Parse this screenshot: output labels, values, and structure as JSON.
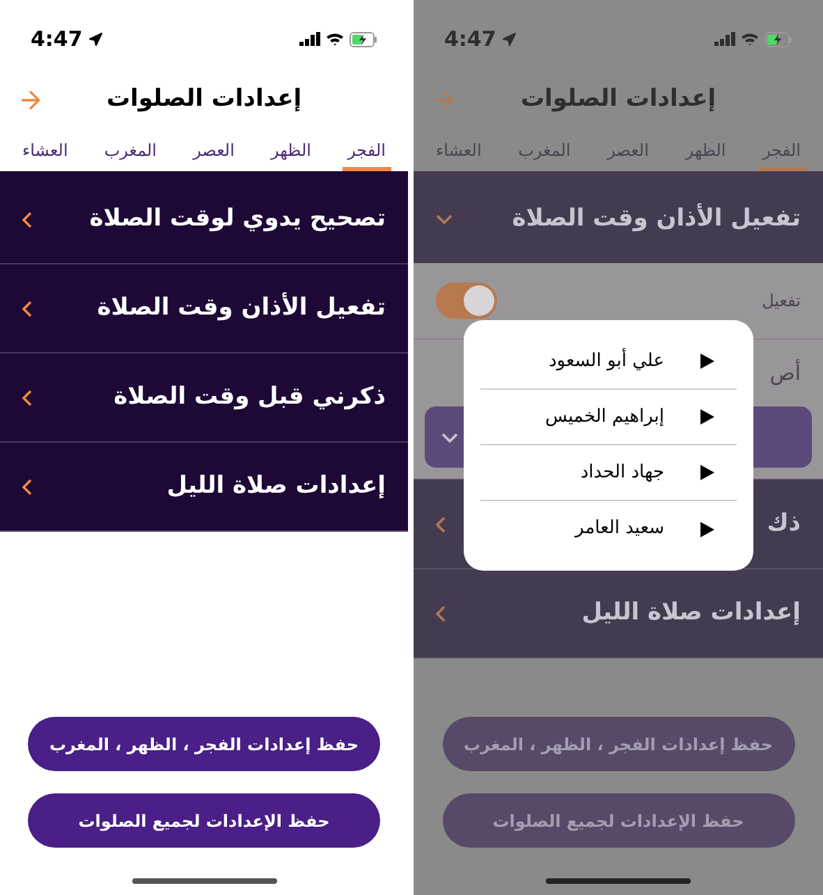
{
  "left_screen": {
    "dimmed": false,
    "status_bar": {
      "time": "4:47"
    },
    "header": {
      "title": "إعدادات الصلوات"
    },
    "tabs": [
      {
        "label": "الفجر",
        "selected": true
      },
      {
        "label": "الظهر",
        "selected": false
      },
      {
        "label": "العصر",
        "selected": false
      },
      {
        "label": "المغرب",
        "selected": false
      },
      {
        "label": "العشاء",
        "selected": false
      }
    ],
    "sections": [
      {
        "title": "تصحيح يدوي لوقت الصلاة",
        "expanded": false
      },
      {
        "title": "تفعيل الأذان وقت الصلاة",
        "expanded": false
      },
      {
        "title": "ذكرني قبل وقت الصلاة",
        "expanded": false
      },
      {
        "title": "إعدادات صلاة الليل",
        "expanded": false
      }
    ],
    "buttons": [
      "حفظ إعدادات الفجر ، الظهر ، المغرب",
      "حفظ الإعدادات لجميع الصلوات"
    ]
  },
  "right_screen": {
    "dimmed": true,
    "status_bar": {
      "time": "4:47"
    },
    "header": {
      "title": "إعدادات الصلوات"
    },
    "tabs": [
      {
        "label": "الفجر",
        "selected": true
      },
      {
        "label": "الظهر",
        "selected": false
      },
      {
        "label": "العصر",
        "selected": false
      },
      {
        "label": "المغرب",
        "selected": false
      },
      {
        "label": "العشاء",
        "selected": false
      }
    ],
    "sections": [
      {
        "title": "تفعيل الأذان وقت الصلاة",
        "expanded": true,
        "rows": [
          {
            "kind": "toggle",
            "label": "تفعيل",
            "on": true
          },
          {
            "kind": "select",
            "label": "أص"
          }
        ]
      },
      {
        "title": "ذك",
        "expanded": false
      },
      {
        "title": "إعدادات صلاة الليل",
        "expanded": false
      }
    ],
    "buttons": [
      "حفظ إعدادات الفجر ، الظهر ، المغرب",
      "حفظ الإعدادات لجميع الصلوات"
    ],
    "menu": {
      "items": [
        "علي أبو السعود",
        "إبراهيم الخميس",
        "جهاد الحداد",
        "سعيد العامر"
      ]
    }
  }
}
